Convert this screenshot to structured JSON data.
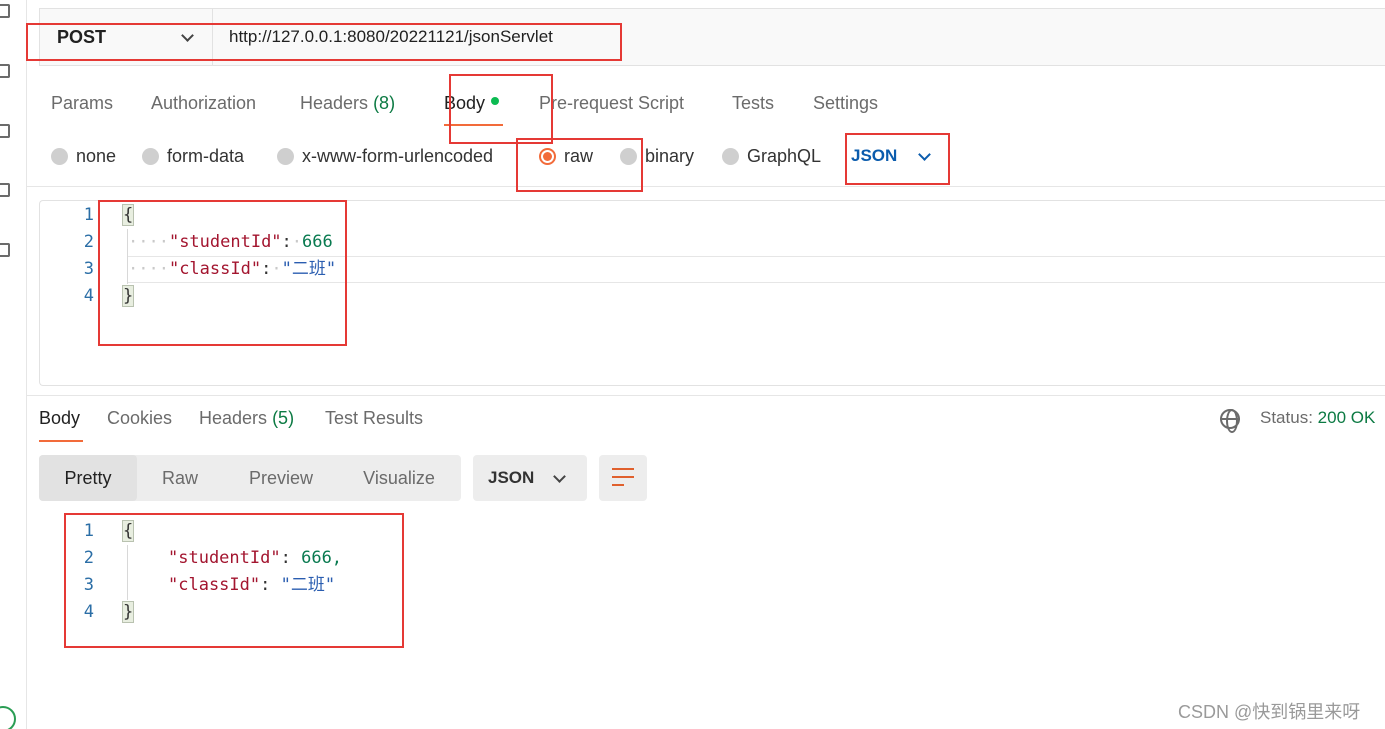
{
  "request": {
    "method": "POST",
    "url": "http://127.0.0.1:8080/20221121/jsonServlet"
  },
  "request_tabs": {
    "params": "Params",
    "authorization": "Authorization",
    "headers": "Headers",
    "headers_count": "(8)",
    "body": "Body",
    "pre_request": "Pre-request Script",
    "tests": "Tests",
    "settings": "Settings"
  },
  "body_types": {
    "none": "none",
    "form_data": "form-data",
    "urlencoded": "x-www-form-urlencoded",
    "raw": "raw",
    "binary": "binary",
    "graphql": "GraphQL",
    "selected_format": "JSON"
  },
  "request_body": {
    "line_numbers": [
      "1",
      "2",
      "3",
      "4"
    ],
    "open_brace": "{",
    "close_brace": "}",
    "key1": "\"studentId\"",
    "val1": "666",
    "key2": "\"classId\"",
    "val2": "\"二班\"",
    "colon": ":"
  },
  "response_tabs": {
    "body": "Body",
    "cookies": "Cookies",
    "headers": "Headers",
    "headers_count": "(5)",
    "test_results": "Test Results"
  },
  "status": {
    "label": "Status:",
    "value": "200 OK"
  },
  "view_modes": {
    "pretty": "Pretty",
    "raw": "Raw",
    "preview": "Preview",
    "visualize": "Visualize",
    "format": "JSON"
  },
  "response_body": {
    "line_numbers": [
      "1",
      "2",
      "3",
      "4"
    ],
    "open_brace": "{",
    "close_brace": "}",
    "key1": "\"studentId\"",
    "val1": "666,",
    "key2": "\"classId\"",
    "val2": "\"二班\"",
    "colon": ":"
  },
  "watermark": "CSDN @快到锅里来呀",
  "colors": {
    "accent": "#f26b3a",
    "success": "#0c7a43",
    "annotation": "#e53935",
    "link": "#0b5cad"
  }
}
